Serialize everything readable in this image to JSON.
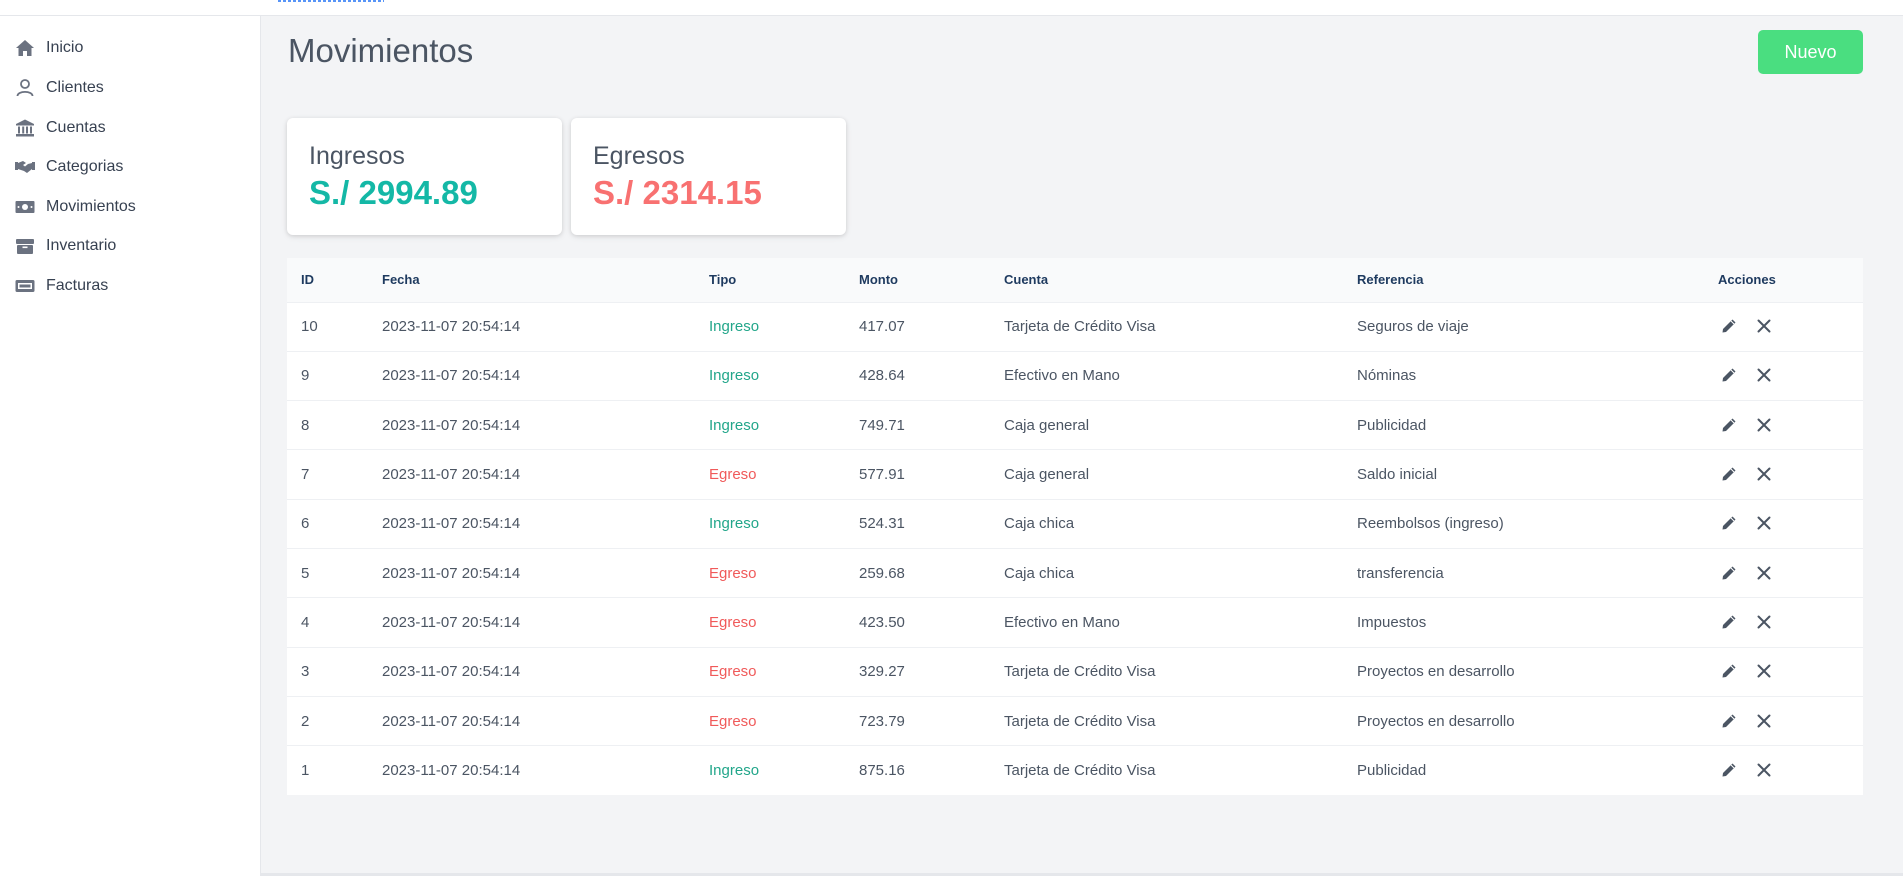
{
  "sidebar": {
    "items": [
      {
        "label": "Inicio",
        "icon": "home-icon"
      },
      {
        "label": "Clientes",
        "icon": "user-icon"
      },
      {
        "label": "Cuentas",
        "icon": "bank-icon"
      },
      {
        "label": "Categorias",
        "icon": "handshake-icon"
      },
      {
        "label": "Movimientos",
        "icon": "money-icon"
      },
      {
        "label": "Inventario",
        "icon": "box-icon"
      },
      {
        "label": "Facturas",
        "icon": "receipt-icon"
      }
    ]
  },
  "header": {
    "title": "Movimientos",
    "new_button": "Nuevo"
  },
  "summary": {
    "income_label": "Ingresos",
    "income_value": "S./ 2994.89",
    "expense_label": "Egresos",
    "expense_value": "S./ 2314.15"
  },
  "colors": {
    "income": "#14b8a6",
    "expense": "#f87171",
    "primary_button": "#4ade80"
  },
  "table": {
    "columns": [
      "ID",
      "Fecha",
      "Tipo",
      "Monto",
      "Cuenta",
      "Referencia",
      "Acciones"
    ],
    "rows": [
      {
        "id": "10",
        "fecha": "2023-11-07 20:54:14",
        "tipo": "Ingreso",
        "monto": "417.07",
        "cuenta": "Tarjeta de Crédito Visa",
        "referencia": "Seguros de viaje"
      },
      {
        "id": "9",
        "fecha": "2023-11-07 20:54:14",
        "tipo": "Ingreso",
        "monto": "428.64",
        "cuenta": "Efectivo en Mano",
        "referencia": "Nóminas"
      },
      {
        "id": "8",
        "fecha": "2023-11-07 20:54:14",
        "tipo": "Ingreso",
        "monto": "749.71",
        "cuenta": "Caja general",
        "referencia": "Publicidad"
      },
      {
        "id": "7",
        "fecha": "2023-11-07 20:54:14",
        "tipo": "Egreso",
        "monto": "577.91",
        "cuenta": "Caja general",
        "referencia": "Saldo inicial"
      },
      {
        "id": "6",
        "fecha": "2023-11-07 20:54:14",
        "tipo": "Ingreso",
        "monto": "524.31",
        "cuenta": "Caja chica",
        "referencia": "Reembolsos (ingreso)"
      },
      {
        "id": "5",
        "fecha": "2023-11-07 20:54:14",
        "tipo": "Egreso",
        "monto": "259.68",
        "cuenta": "Caja chica",
        "referencia": "transferencia"
      },
      {
        "id": "4",
        "fecha": "2023-11-07 20:54:14",
        "tipo": "Egreso",
        "monto": "423.50",
        "cuenta": "Efectivo en Mano",
        "referencia": "Impuestos"
      },
      {
        "id": "3",
        "fecha": "2023-11-07 20:54:14",
        "tipo": "Egreso",
        "monto": "329.27",
        "cuenta": "Tarjeta de Crédito Visa",
        "referencia": "Proyectos en desarrollo"
      },
      {
        "id": "2",
        "fecha": "2023-11-07 20:54:14",
        "tipo": "Egreso",
        "monto": "723.79",
        "cuenta": "Tarjeta de Crédito Visa",
        "referencia": "Proyectos en desarrollo"
      },
      {
        "id": "1",
        "fecha": "2023-11-07 20:54:14",
        "tipo": "Ingreso",
        "monto": "875.16",
        "cuenta": "Tarjeta de Crédito Visa",
        "referencia": "Publicidad"
      }
    ]
  }
}
